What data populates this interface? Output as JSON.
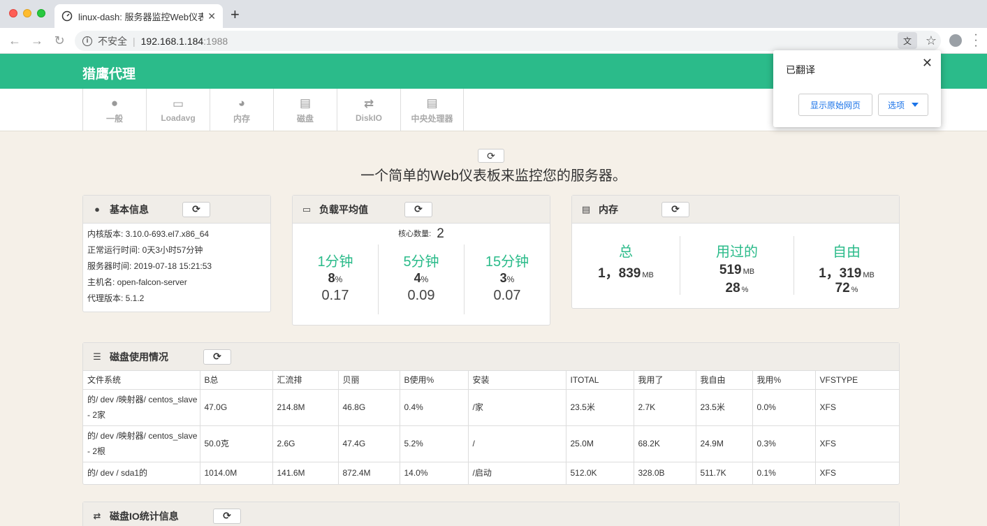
{
  "browser": {
    "tab_title": "linux-dash: 服务器监控Web仪表",
    "tab_close": "✕",
    "new_tab": "+",
    "insecure_label": "不安全",
    "url_host": "192.168.1.184",
    "url_port": ":1988"
  },
  "brand": "猎鹰代理",
  "nav": [
    {
      "label": "一般",
      "icon": "info-icon"
    },
    {
      "label": "Loadavg",
      "icon": "laptop-icon"
    },
    {
      "label": "内存",
      "icon": "dashboard-icon"
    },
    {
      "label": "磁盘",
      "icon": "list-icon"
    },
    {
      "label": "DiskIO",
      "icon": "exchange-icon"
    },
    {
      "label": "中央处理器",
      "icon": "list-icon"
    }
  ],
  "headline": "一个简单的Web仪表板来监控您的服务器。",
  "basic_info": {
    "title": "基本信息",
    "lines": [
      "内核版本: 3.10.0-693.el7.x86_64",
      "正常运行时间: 0天3小时57分钟",
      "服务器时间: 2019-07-18 15:21:53",
      "主机名: open-falcon-server",
      "代理版本: 5.1.2"
    ]
  },
  "load": {
    "title": "负载平均值",
    "cores_label": "核心数量:",
    "cores": "2",
    "cols": [
      {
        "title": "1分钟",
        "pct": "8",
        "unit": "%",
        "value": "0.17"
      },
      {
        "title": "5分钟",
        "pct": "4",
        "unit": "%",
        "value": "0.09"
      },
      {
        "title": "15分钟",
        "pct": "3",
        "unit": "%",
        "value": "0.07"
      }
    ]
  },
  "memory": {
    "title": "内存",
    "cols": [
      {
        "title": "总",
        "num": "1，839",
        "unit": "MB"
      },
      {
        "title": "用过的",
        "num": "519",
        "unit": "MB",
        "pct": "28",
        "pct_unit": "%"
      },
      {
        "title": "自由",
        "num": "1，319",
        "unit": "MB",
        "pct": "72",
        "pct_unit": "%"
      }
    ]
  },
  "disk": {
    "title": "磁盘使用情况",
    "headers": [
      "文件系统",
      "B总",
      "汇流排",
      "贝丽",
      "B使用%",
      "安装",
      "ITOTAL",
      "我用了",
      "我自由",
      "我用%",
      "VFSTYPE"
    ],
    "rows": [
      [
        "的/ dev /映射器/ centos_slave - 2家",
        "47.0G",
        "214.8M",
        "46.8G",
        "0.4%",
        "/家",
        "23.5米",
        "2.7K",
        "23.5米",
        "0.0%",
        "XFS"
      ],
      [
        "的/ dev /映射器/ centos_slave - 2根",
        "50.0克",
        "2.6G",
        "47.4G",
        "5.2%",
        "/",
        "25.0M",
        "68.2K",
        "24.9M",
        "0.3%",
        "XFS"
      ],
      [
        "的/ dev / sda1的",
        "1014.0M",
        "141.6M",
        "872.4M",
        "14.0%",
        "/启动",
        "512.0K",
        "328.0B",
        "511.7K",
        "0.1%",
        "XFS"
      ]
    ]
  },
  "diskio": {
    "title": "磁盘IO统计信息"
  },
  "translate_popup": {
    "title": "已翻译",
    "close": "✕",
    "show_original": "显示原始网页",
    "options": "选项"
  },
  "colors": {
    "accent": "#2bbb8a",
    "page_bg": "#f5f0e8"
  }
}
